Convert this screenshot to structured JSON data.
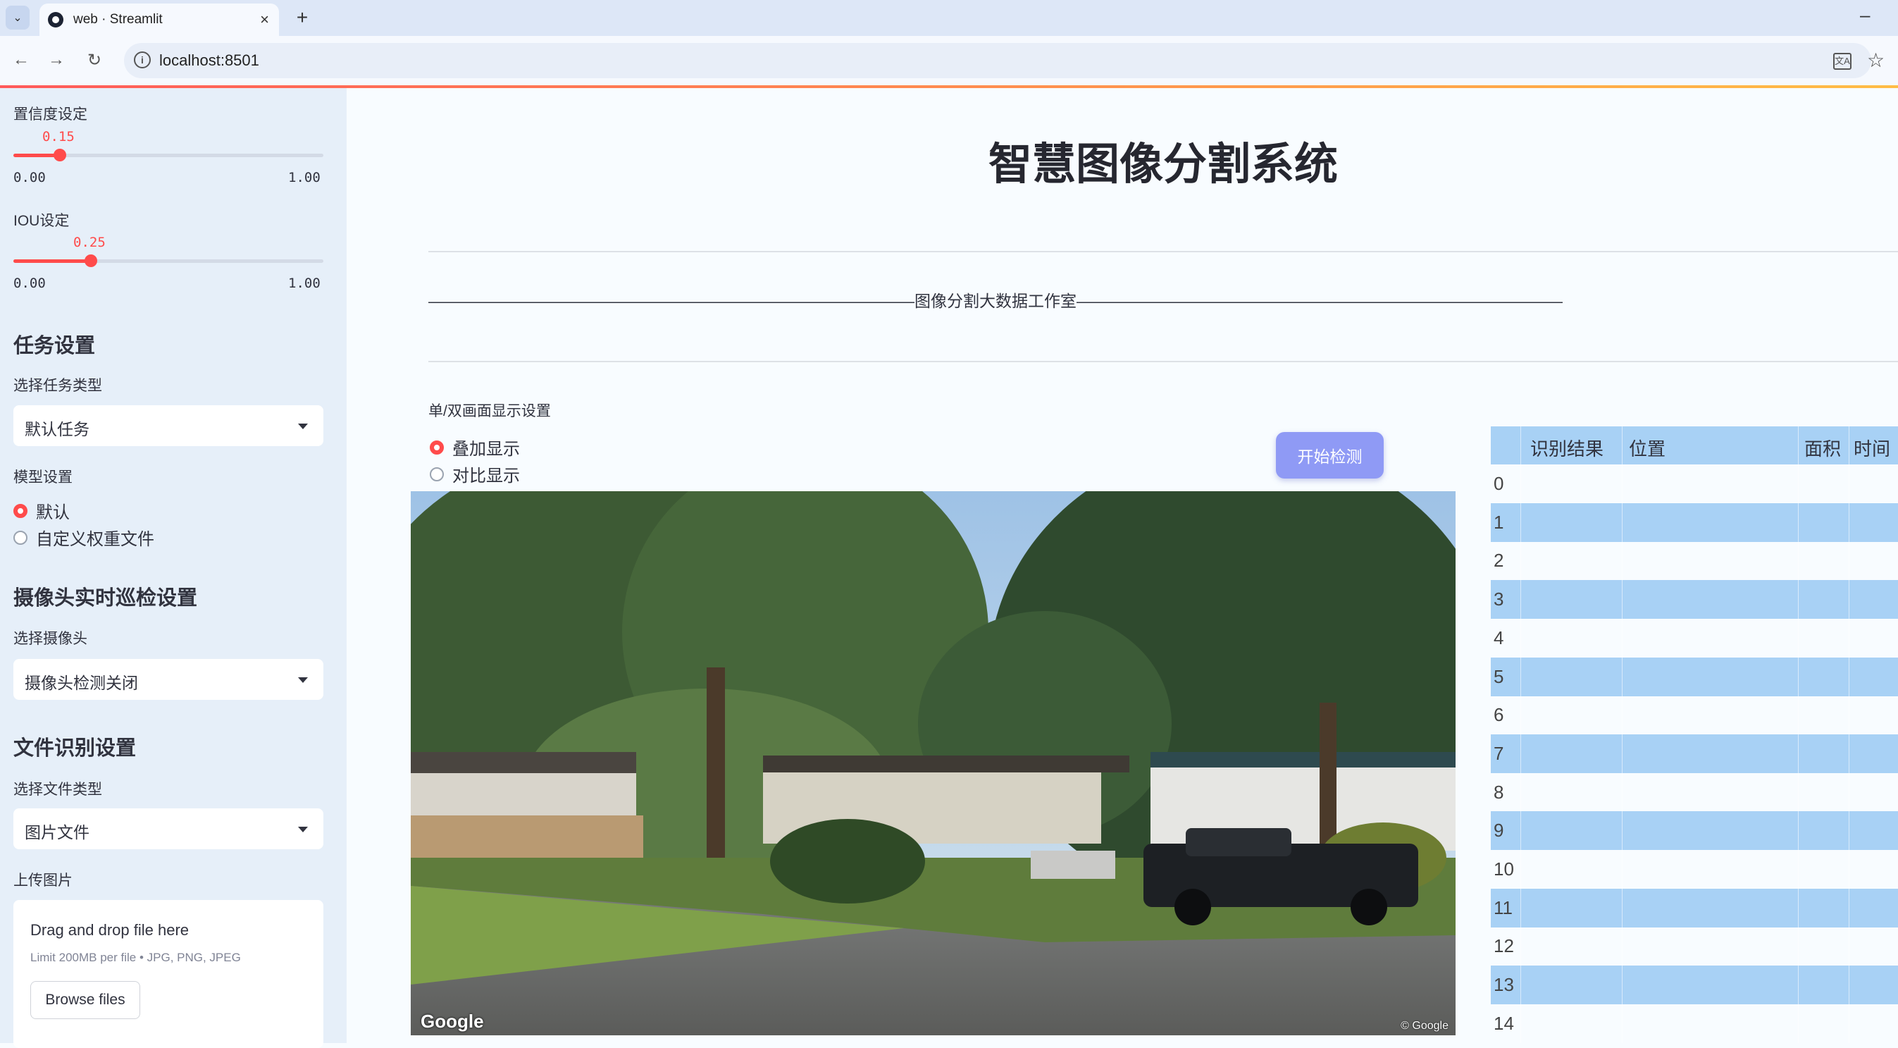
{
  "browser": {
    "tab_title": "web · Streamlit",
    "url": "localhost:8501"
  },
  "sidebar": {
    "confidence": {
      "label": "置信度设定",
      "value": "0.15",
      "value_num": 0.15,
      "min": "0.00",
      "max": "1.00"
    },
    "iou": {
      "label": "IOU设定",
      "value": "0.25",
      "value_num": 0.25,
      "min": "0.00",
      "max": "1.00"
    },
    "task_section": "任务设置",
    "task_type_label": "选择任务类型",
    "task_type_value": "默认任务",
    "model_label": "模型设置",
    "model_options": [
      "默认",
      "自定义权重文件"
    ],
    "model_selected": "默认",
    "camera_section": "摄像头实时巡检设置",
    "camera_label": "选择摄像头",
    "camera_value": "摄像头检测关闭",
    "file_section": "文件识别设置",
    "file_type_label": "选择文件类型",
    "file_type_value": "图片文件",
    "upload_label": "上传图片",
    "upload_main": "Drag and drop file here",
    "upload_sub": "Limit 200MB per file • JPG, PNG, JPEG",
    "browse_label": "Browse files"
  },
  "main": {
    "title": "智慧图像分割系统",
    "subtitle": "——————————————————————————————图像分割大数据工作室——————————————————————————————",
    "mode_label": "单/双画面显示设置",
    "mode_options": [
      "叠加显示",
      "对比显示"
    ],
    "mode_selected": "叠加显示",
    "detect_button": "开始检测",
    "image_watermark": "Google",
    "image_copyright": "© Google"
  },
  "table": {
    "columns": [
      "识别结果",
      "位置",
      "面积",
      "时间"
    ],
    "row_indices": [
      "0",
      "1",
      "2",
      "3",
      "4",
      "5",
      "6",
      "7",
      "8",
      "9",
      "10",
      "11",
      "12",
      "13",
      "14"
    ]
  },
  "colors": {
    "accent": "#ff4b4b",
    "sidebar_bg": "#e6eff9",
    "table_header": "#a8d1f5",
    "button": "#8f9af5"
  }
}
